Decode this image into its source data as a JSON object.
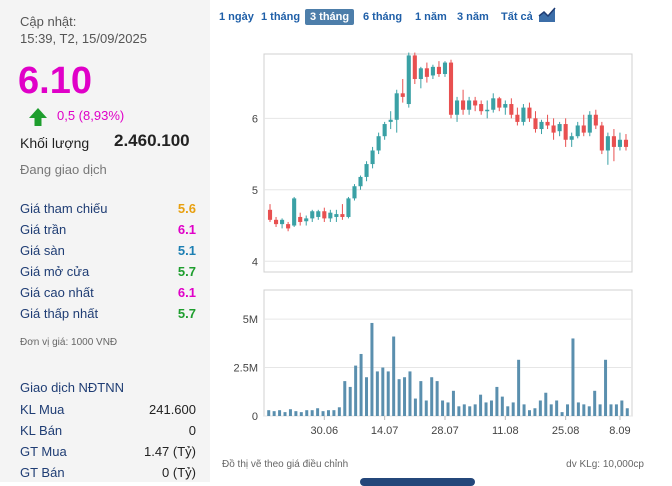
{
  "header": {
    "updated_label": "Cập nhật:",
    "updated_time": "15:39, T2, 15/09/2025"
  },
  "quote": {
    "price": "6.10",
    "change": "0,5 (8,93%)",
    "volume_label": "Khối lượng",
    "volume": "2.460.100",
    "status": "Đang giao dịch",
    "price_color": "#e000c8",
    "up_color": "#1e9e2e"
  },
  "prices": [
    {
      "label": "Giá tham chiếu",
      "value": "5.6",
      "color": "#e8a010"
    },
    {
      "label": "Giá trần",
      "value": "6.1",
      "color": "#e000c8"
    },
    {
      "label": "Giá sàn",
      "value": "5.1",
      "color": "#1c7fb3"
    },
    {
      "label": "Giá mở cửa",
      "value": "5.7",
      "color": "#1e9e2e"
    },
    {
      "label": "Giá cao nhất",
      "value": "6.1",
      "color": "#e000c8"
    },
    {
      "label": "Giá thấp nhất",
      "value": "5.7",
      "color": "#1e9e2e"
    }
  ],
  "unit_note": "Đơn vị giá: 1000 VNĐ",
  "foreign": {
    "title": "Giao dịch NĐTNN",
    "rows": [
      {
        "label": "KL Mua",
        "value": "241.600"
      },
      {
        "label": "KL Bán",
        "value": "0"
      },
      {
        "label": "GT Mua",
        "value": "1.47 (Tỷ)"
      },
      {
        "label": "GT Bán",
        "value": "0 (Tỷ)"
      }
    ]
  },
  "tabs": [
    "1 ngày",
    "1 tháng",
    "3 tháng",
    "6 tháng",
    "1 năm",
    "3 năm",
    "Tất cả"
  ],
  "active_tab": "3 tháng",
  "chart_footer": {
    "left": "Đồ thị vẽ theo giá điều chỉnh",
    "right": "dv KLg: 10,000cp"
  },
  "chart_data": {
    "type": "candlestick",
    "colors": {
      "up": "#3aa1a5",
      "down": "#e85050",
      "volume": "#5a8fae"
    },
    "price_ticks": [
      "4",
      "5",
      "6"
    ],
    "ylim": [
      3.85,
      6.9
    ],
    "volume_ticks": [
      "0",
      "2.5M",
      "5M"
    ],
    "volume_ylim": [
      0,
      6.5
    ],
    "x_ticks": [
      {
        "label": "30.06",
        "index": 9
      },
      {
        "label": "14.07",
        "index": 19
      },
      {
        "label": "28.07",
        "index": 29
      },
      {
        "label": "11.08",
        "index": 39
      },
      {
        "label": "25.08",
        "index": 49
      },
      {
        "label": "8.09",
        "index": 58
      }
    ],
    "candles": [
      [
        4.72,
        4.8,
        4.55,
        4.58
      ],
      [
        4.58,
        4.62,
        4.48,
        4.52
      ],
      [
        4.52,
        4.6,
        4.46,
        4.58
      ],
      [
        4.52,
        4.55,
        4.42,
        4.46
      ],
      [
        4.5,
        4.9,
        4.48,
        4.88
      ],
      [
        4.62,
        4.68,
        4.5,
        4.55
      ],
      [
        4.56,
        4.64,
        4.5,
        4.6
      ],
      [
        4.6,
        4.72,
        4.55,
        4.7
      ],
      [
        4.62,
        4.72,
        4.58,
        4.7
      ],
      [
        4.7,
        4.75,
        4.55,
        4.6
      ],
      [
        4.6,
        4.72,
        4.55,
        4.68
      ],
      [
        4.62,
        4.72,
        4.55,
        4.66
      ],
      [
        4.66,
        4.8,
        4.58,
        4.62
      ],
      [
        4.62,
        4.9,
        4.6,
        4.88
      ],
      [
        4.88,
        5.08,
        4.85,
        5.05
      ],
      [
        5.05,
        5.2,
        5.0,
        5.18
      ],
      [
        5.18,
        5.4,
        5.12,
        5.36
      ],
      [
        5.36,
        5.6,
        5.3,
        5.55
      ],
      [
        5.55,
        5.8,
        5.5,
        5.75
      ],
      [
        5.75,
        5.95,
        5.7,
        5.92
      ],
      [
        5.95,
        6.1,
        5.85,
        5.98
      ],
      [
        5.98,
        6.4,
        5.8,
        6.35
      ],
      [
        6.35,
        6.55,
        6.22,
        6.3
      ],
      [
        6.2,
        6.92,
        6.15,
        6.88
      ],
      [
        6.88,
        6.92,
        6.48,
        6.55
      ],
      [
        6.55,
        6.72,
        6.42,
        6.7
      ],
      [
        6.7,
        6.78,
        6.5,
        6.58
      ],
      [
        6.6,
        6.75,
        6.55,
        6.72
      ],
      [
        6.72,
        6.8,
        6.58,
        6.62
      ],
      [
        6.62,
        6.8,
        6.58,
        6.78
      ],
      [
        6.78,
        6.82,
        6.0,
        6.05
      ],
      [
        6.05,
        6.3,
        5.95,
        6.25
      ],
      [
        6.25,
        6.4,
        6.05,
        6.12
      ],
      [
        6.12,
        6.3,
        6.05,
        6.25
      ],
      [
        6.25,
        6.3,
        6.1,
        6.18
      ],
      [
        6.2,
        6.25,
        6.05,
        6.1
      ],
      [
        6.1,
        6.25,
        6.0,
        6.12
      ],
      [
        6.12,
        6.35,
        6.08,
        6.28
      ],
      [
        6.28,
        6.3,
        6.1,
        6.15
      ],
      [
        6.15,
        6.25,
        6.05,
        6.2
      ],
      [
        6.2,
        6.28,
        6.0,
        6.05
      ],
      [
        6.05,
        6.15,
        5.9,
        5.95
      ],
      [
        5.95,
        6.2,
        5.9,
        6.15
      ],
      [
        6.15,
        6.22,
        5.95,
        6.0
      ],
      [
        6.0,
        6.1,
        5.8,
        5.85
      ],
      [
        5.85,
        5.98,
        5.78,
        5.95
      ],
      [
        5.95,
        6.05,
        5.85,
        5.9
      ],
      [
        5.9,
        6.0,
        5.7,
        5.8
      ],
      [
        5.82,
        5.95,
        5.75,
        5.92
      ],
      [
        5.92,
        6.0,
        5.6,
        5.7
      ],
      [
        5.7,
        5.8,
        5.6,
        5.75
      ],
      [
        5.75,
        5.95,
        5.72,
        5.9
      ],
      [
        5.9,
        6.05,
        5.75,
        5.8
      ],
      [
        5.8,
        6.1,
        5.75,
        6.05
      ],
      [
        6.05,
        6.12,
        5.85,
        5.9
      ],
      [
        5.9,
        5.95,
        5.5,
        5.55
      ],
      [
        5.55,
        5.8,
        5.35,
        5.75
      ],
      [
        5.75,
        5.85,
        5.4,
        5.6
      ],
      [
        5.6,
        5.8,
        5.55,
        5.7
      ],
      [
        5.7,
        5.78,
        5.55,
        5.6
      ]
    ],
    "volume": [
      0.3,
      0.25,
      0.3,
      0.2,
      0.35,
      0.25,
      0.2,
      0.3,
      0.3,
      0.4,
      0.25,
      0.3,
      0.3,
      0.45,
      1.8,
      1.5,
      2.6,
      3.2,
      2.0,
      4.8,
      2.3,
      2.5,
      2.3,
      4.1,
      1.9,
      2.0,
      2.3,
      0.9,
      1.8,
      0.8,
      2.0,
      1.8,
      0.8,
      0.7,
      1.3,
      0.5,
      0.6,
      0.5,
      0.6,
      1.1,
      0.7,
      0.8,
      1.5,
      1.0,
      0.5,
      0.7,
      2.9,
      0.6,
      0.3,
      0.4,
      0.8,
      1.2,
      0.6,
      0.8,
      0.2,
      0.6,
      4.0,
      0.7,
      0.6,
      0.5,
      1.3,
      0.6,
      2.9,
      0.6,
      0.6,
      0.8,
      0.4
    ]
  }
}
